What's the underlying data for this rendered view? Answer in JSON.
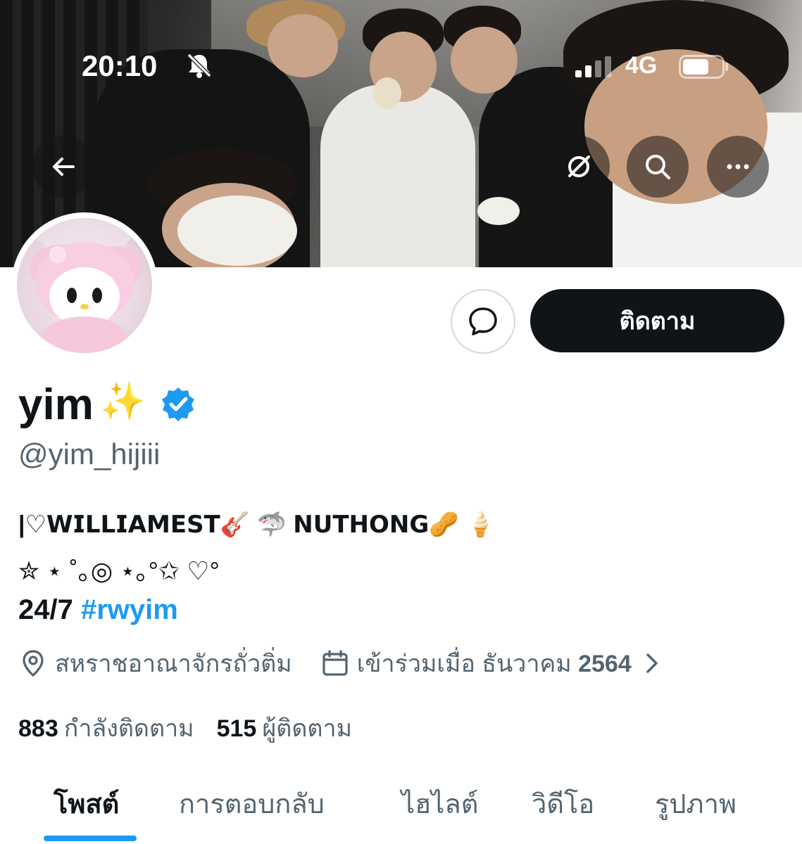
{
  "status_bar": {
    "time": "20:10",
    "network": "4G",
    "icons": [
      "bell-slash-icon",
      "signal-icon",
      "battery-icon"
    ]
  },
  "header_buttons": {
    "back_icon": "arrow-left-icon",
    "grok_icon": "grok-icon",
    "search_icon": "search-icon",
    "more_icon": "more-horizontal-icon"
  },
  "profile": {
    "display_name": "yim",
    "name_emoji": "✨",
    "verified": true,
    "handle": "@yim_hijiii",
    "bio_line1": "|♡𝗪𝗜𝗟𝗟𝗜𝗔𝗠𝗘𝗦𝗧🎸 🦈 𝗡𝗨𝗧𝗛𝗢𝗡𝗚🥜 🍦",
    "bio_line2": "✮ ⋆ ˚｡◎ ⋆｡°✩ ♡°",
    "bio_line3_prefix": "24/7 ",
    "bio_line3_hashtag": "#rwyim",
    "location": "สหราชอาณาจักรถั่วติ่ม",
    "joined_prefix": "เข้าร่วมเมื่อ ธันวาคม",
    "joined_year": "2564",
    "following_count": "883",
    "following_label": "กำลังติดตาม",
    "followers_count": "515",
    "followers_label": "ผู้ติดตาม"
  },
  "actions": {
    "follow_label": "ติดตาม",
    "message_icon": "message-bubble-icon"
  },
  "tabs": [
    {
      "label": "โพสต์",
      "active": true
    },
    {
      "label": "การตอบกลับ",
      "active": false
    },
    {
      "label": "ไฮไลต์",
      "active": false
    },
    {
      "label": "วิดีโอ",
      "active": false
    },
    {
      "label": "รูปภาพ",
      "active": false
    }
  ],
  "colors": {
    "accent": "#1d9bf0",
    "text_primary": "#0f1419",
    "text_secondary": "#536471",
    "follow_button": "#0f1419"
  }
}
